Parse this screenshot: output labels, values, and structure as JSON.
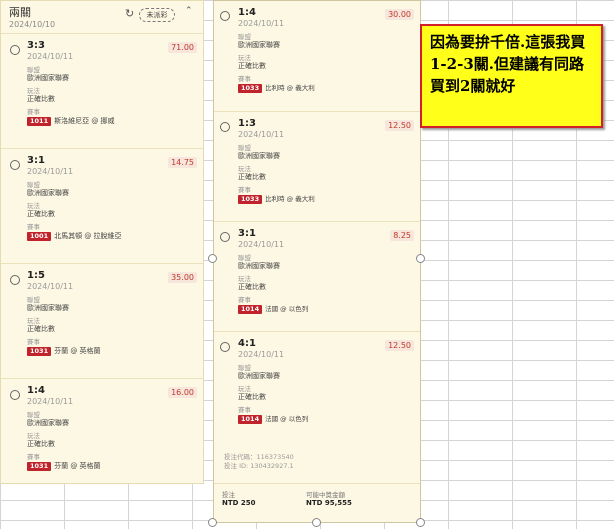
{
  "left_panel": {
    "title": "兩關",
    "date": "2024/10/10",
    "refresh_icon": "refresh-icon",
    "unsettled_label": "未派彩",
    "caret_icon": "caret-up-icon",
    "bets": [
      {
        "score": "3:3",
        "date": "2024/10/11",
        "odds": "71.00",
        "league_label": "聯盟",
        "league": "歐洲國家聯賽",
        "type_label": "玩法",
        "type": "正確比數",
        "match_label": "賽事",
        "code": "1011",
        "match": "斯洛維尼亞 @ 挪威"
      },
      {
        "score": "3:1",
        "date": "2024/10/11",
        "odds": "14.75",
        "league_label": "聯盟",
        "league": "歐洲國家聯賽",
        "type_label": "玩法",
        "type": "正確比數",
        "match_label": "賽事",
        "code": "1001",
        "match": "北馬其頓 @ 拉脫維亞"
      },
      {
        "score": "1:5",
        "date": "2024/10/11",
        "odds": "35.00",
        "league_label": "聯盟",
        "league": "歐洲國家聯賽",
        "type_label": "玩法",
        "type": "正確比數",
        "match_label": "賽事",
        "code": "1031",
        "match": "芬蘭 @ 英格蘭"
      },
      {
        "score": "1:4",
        "date": "2024/10/11",
        "odds": "16.00",
        "league_label": "聯盟",
        "league": "歐洲國家聯賽",
        "type_label": "玩法",
        "type": "正確比數",
        "match_label": "賽事",
        "code": "1031",
        "match": "芬蘭 @ 英格蘭"
      }
    ]
  },
  "right_panel": {
    "bets": [
      {
        "score": "1:4",
        "date": "2024/10/11",
        "odds": "30.00",
        "league_label": "聯盟",
        "league": "歐洲國家聯賽",
        "type_label": "玩法",
        "type": "正確比數",
        "match_label": "賽事",
        "code": "1033",
        "match": "比利時 @ 義大利"
      },
      {
        "score": "1:3",
        "date": "2024/10/11",
        "odds": "12.50",
        "league_label": "聯盟",
        "league": "歐洲國家聯賽",
        "type_label": "玩法",
        "type": "正確比數",
        "match_label": "賽事",
        "code": "1033",
        "match": "比利時 @ 義大利"
      },
      {
        "score": "3:1",
        "date": "2024/10/11",
        "odds": "8.25",
        "league_label": "聯盟",
        "league": "歐洲國家聯賽",
        "type_label": "玩法",
        "type": "正確比數",
        "match_label": "賽事",
        "code": "1014",
        "match": "法國 @ 以色列"
      },
      {
        "score": "4:1",
        "date": "2024/10/11",
        "odds": "12.50",
        "league_label": "聯盟",
        "league": "歐洲國家聯賽",
        "type_label": "玩法",
        "type": "正確比數",
        "match_label": "賽事",
        "code": "1014",
        "match": "法國 @ 以色列"
      }
    ],
    "ticket_code": "投注代碼：116373540",
    "ticket_id": "投注 ID: 130432927.1",
    "stake_label": "投注",
    "stake_value": "NTD 250",
    "payout_label": "可能中獎金額",
    "payout_value": "NTD 95,555"
  },
  "note": {
    "text": "因為要拚千倍.這張我買1-2-3關.但建議有同路買到2關就好",
    "border_color": "#d32027",
    "background_color": "#ffff1a"
  }
}
